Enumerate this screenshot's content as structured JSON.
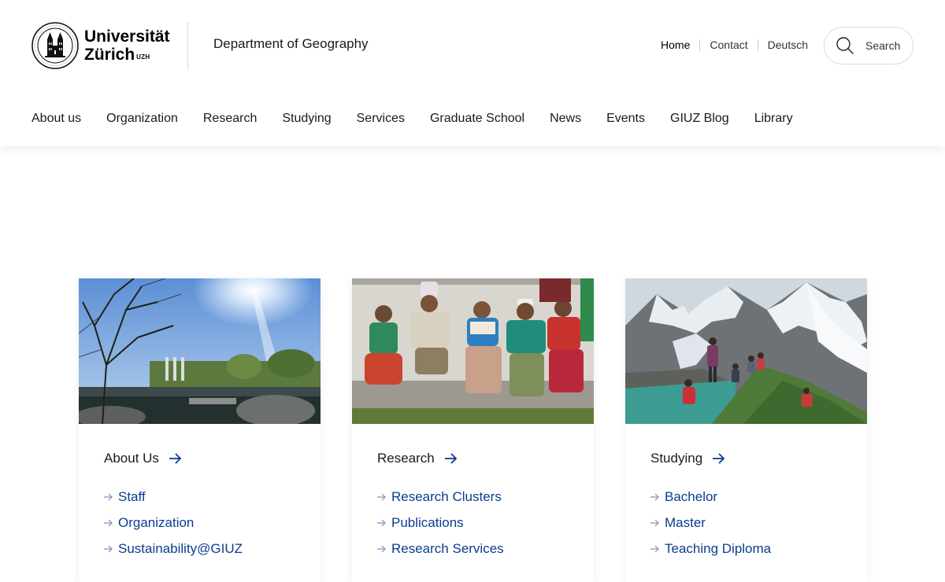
{
  "brand": {
    "university_line1": "Universität",
    "university_line2": "Zürich",
    "university_sup": "UZH",
    "department": "Department of Geography"
  },
  "utility_nav": [
    {
      "label": "Home"
    },
    {
      "label": "Contact"
    },
    {
      "label": "Deutsch"
    }
  ],
  "search": {
    "label": "Search"
  },
  "main_nav": [
    {
      "label": "About us"
    },
    {
      "label": "Organization"
    },
    {
      "label": "Research"
    },
    {
      "label": "Studying"
    },
    {
      "label": "Services"
    },
    {
      "label": "Graduate School"
    },
    {
      "label": "News"
    },
    {
      "label": "Events"
    },
    {
      "label": "GIUZ Blog"
    },
    {
      "label": "Library"
    }
  ],
  "cards": [
    {
      "title": "About Us",
      "links": [
        "Staff",
        "Organization",
        "Sustainability@GIUZ"
      ]
    },
    {
      "title": "Research",
      "links": [
        "Research Clusters",
        "Publications",
        "Research Services"
      ]
    },
    {
      "title": "Studying",
      "links": [
        "Bachelor",
        "Master",
        "Teaching Diploma"
      ]
    }
  ],
  "colors": {
    "link": "#0c3c8f",
    "text": "#1a1a1a",
    "border": "#dcdcdc"
  }
}
